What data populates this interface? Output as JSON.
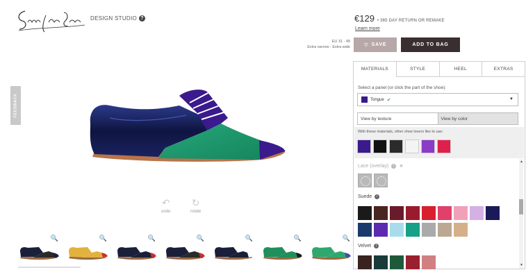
{
  "header": {
    "logo_text": "Shoes of Prey",
    "studio_label": "DESIGN STUDIO",
    "help_icon": "question-circle-icon"
  },
  "pricing": {
    "price": "€129",
    "return_policy": "• 365 DAY RETURN OR REMAKE",
    "learn_more": "Learn more"
  },
  "size": {
    "range": "EU 31 - 49",
    "widths": "Extra narrow - Extra wide"
  },
  "actions": {
    "save_label": "SAVE",
    "save_icon": "heart-icon",
    "add_to_bag_label": "ADD TO BAG"
  },
  "feedback": {
    "label": "FEEDBACK"
  },
  "tools": {
    "undo_label": "undo",
    "rotate_label": "rotate"
  },
  "thumbnails": [
    {
      "upper": "#1a1f3a",
      "toe": "#1a1f3a",
      "accent": "#2a2a2a"
    },
    {
      "upper": "#e3b23c",
      "toe": "#c9302c",
      "accent": "#e3b23c"
    },
    {
      "upper": "#1a1f3a",
      "toe": "#c9302c",
      "accent": "#1a1f3a"
    },
    {
      "upper": "#1a1f3a",
      "toe": "#c9302c",
      "accent": "#2a2a2a"
    },
    {
      "upper": "#1a1f3a",
      "toe": "#ffffff",
      "accent": "#1a1f3a"
    },
    {
      "upper": "#1f8f5c",
      "toe": "#1a1a1a",
      "accent": "#1f8f5c"
    },
    {
      "upper": "#2fa86e",
      "toe": "#4a4aa8",
      "accent": "#2fa86e"
    }
  ],
  "panel": {
    "tabs": [
      {
        "label": "MATERIALS",
        "active": true
      },
      {
        "label": "STYLE",
        "active": false
      },
      {
        "label": "HEEL",
        "active": false
      },
      {
        "label": "EXTRAS",
        "active": false
      }
    ],
    "select_prompt": "Select a panel (or click the part of the shoe):",
    "selected_panel": "Tongue",
    "selected_color": "#3a1a8c",
    "view_by_texture": "View by texture",
    "view_by_color": "View by color",
    "recommend_label": "With these materials, other shoe lovers like to use:",
    "recommended": [
      "#3a1a8c",
      "#111111",
      "#2b2b2b",
      "#f4f4f4",
      "#8a3cc7",
      "#e0204c"
    ],
    "sections": {
      "lace_overlay": "Lace (overlay)",
      "suede": "Suede",
      "velvet": "Velvet"
    },
    "suede_row1": [
      "#1a1a1a",
      "#4a2420",
      "#6b1a2a",
      "#9a1b2d",
      "#d81f2e",
      "#e0406a",
      "#f0a0b8",
      "#d4b0e4",
      "#1a1a5a"
    ],
    "suede_row2": [
      "#1a3a6e",
      "#5b2ab0",
      "#a8dcec",
      "#16a085",
      "#aaaaaa",
      "#bba792",
      "#d4b08a"
    ],
    "velvet_row": [
      "#3a2420",
      "#1a3a3a",
      "#1e5a3a",
      "#9a2030",
      "#d08080"
    ]
  }
}
